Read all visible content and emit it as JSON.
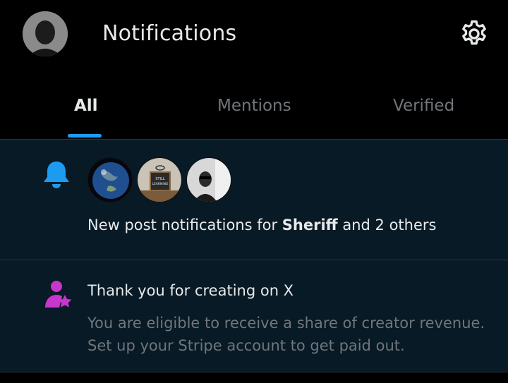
{
  "header": {
    "title": "Notifications",
    "icons": {
      "avatar": "avatar",
      "settings": "gear-icon"
    }
  },
  "tabs": [
    {
      "label": "All",
      "active": true
    },
    {
      "label": "Mentions",
      "active": false
    },
    {
      "label": "Verified",
      "active": false
    }
  ],
  "notifications": [
    {
      "icon": "bell-icon",
      "thumbnails": [
        "earth-avatar",
        "still-learning-avatar",
        "person-avatar"
      ],
      "thumbnail_text": "STILL LEARNING",
      "text_prefix": "New post notifications for ",
      "text_bold": "Sheriff",
      "text_suffix": " and 2 others"
    },
    {
      "icon": "creator-star-icon",
      "title": "Thank you for creating on X",
      "body_line1": "You are eligible to receive a share of creator revenue.",
      "body_line2": "Set up your Stripe account to get paid out."
    }
  ],
  "colors": {
    "background": "#000000",
    "list_background": "#071a26",
    "accent_blue": "#1d9bf0",
    "creator_purple": "#c936cc",
    "text_primary": "#e7e9ea",
    "text_secondary": "#71767b"
  }
}
